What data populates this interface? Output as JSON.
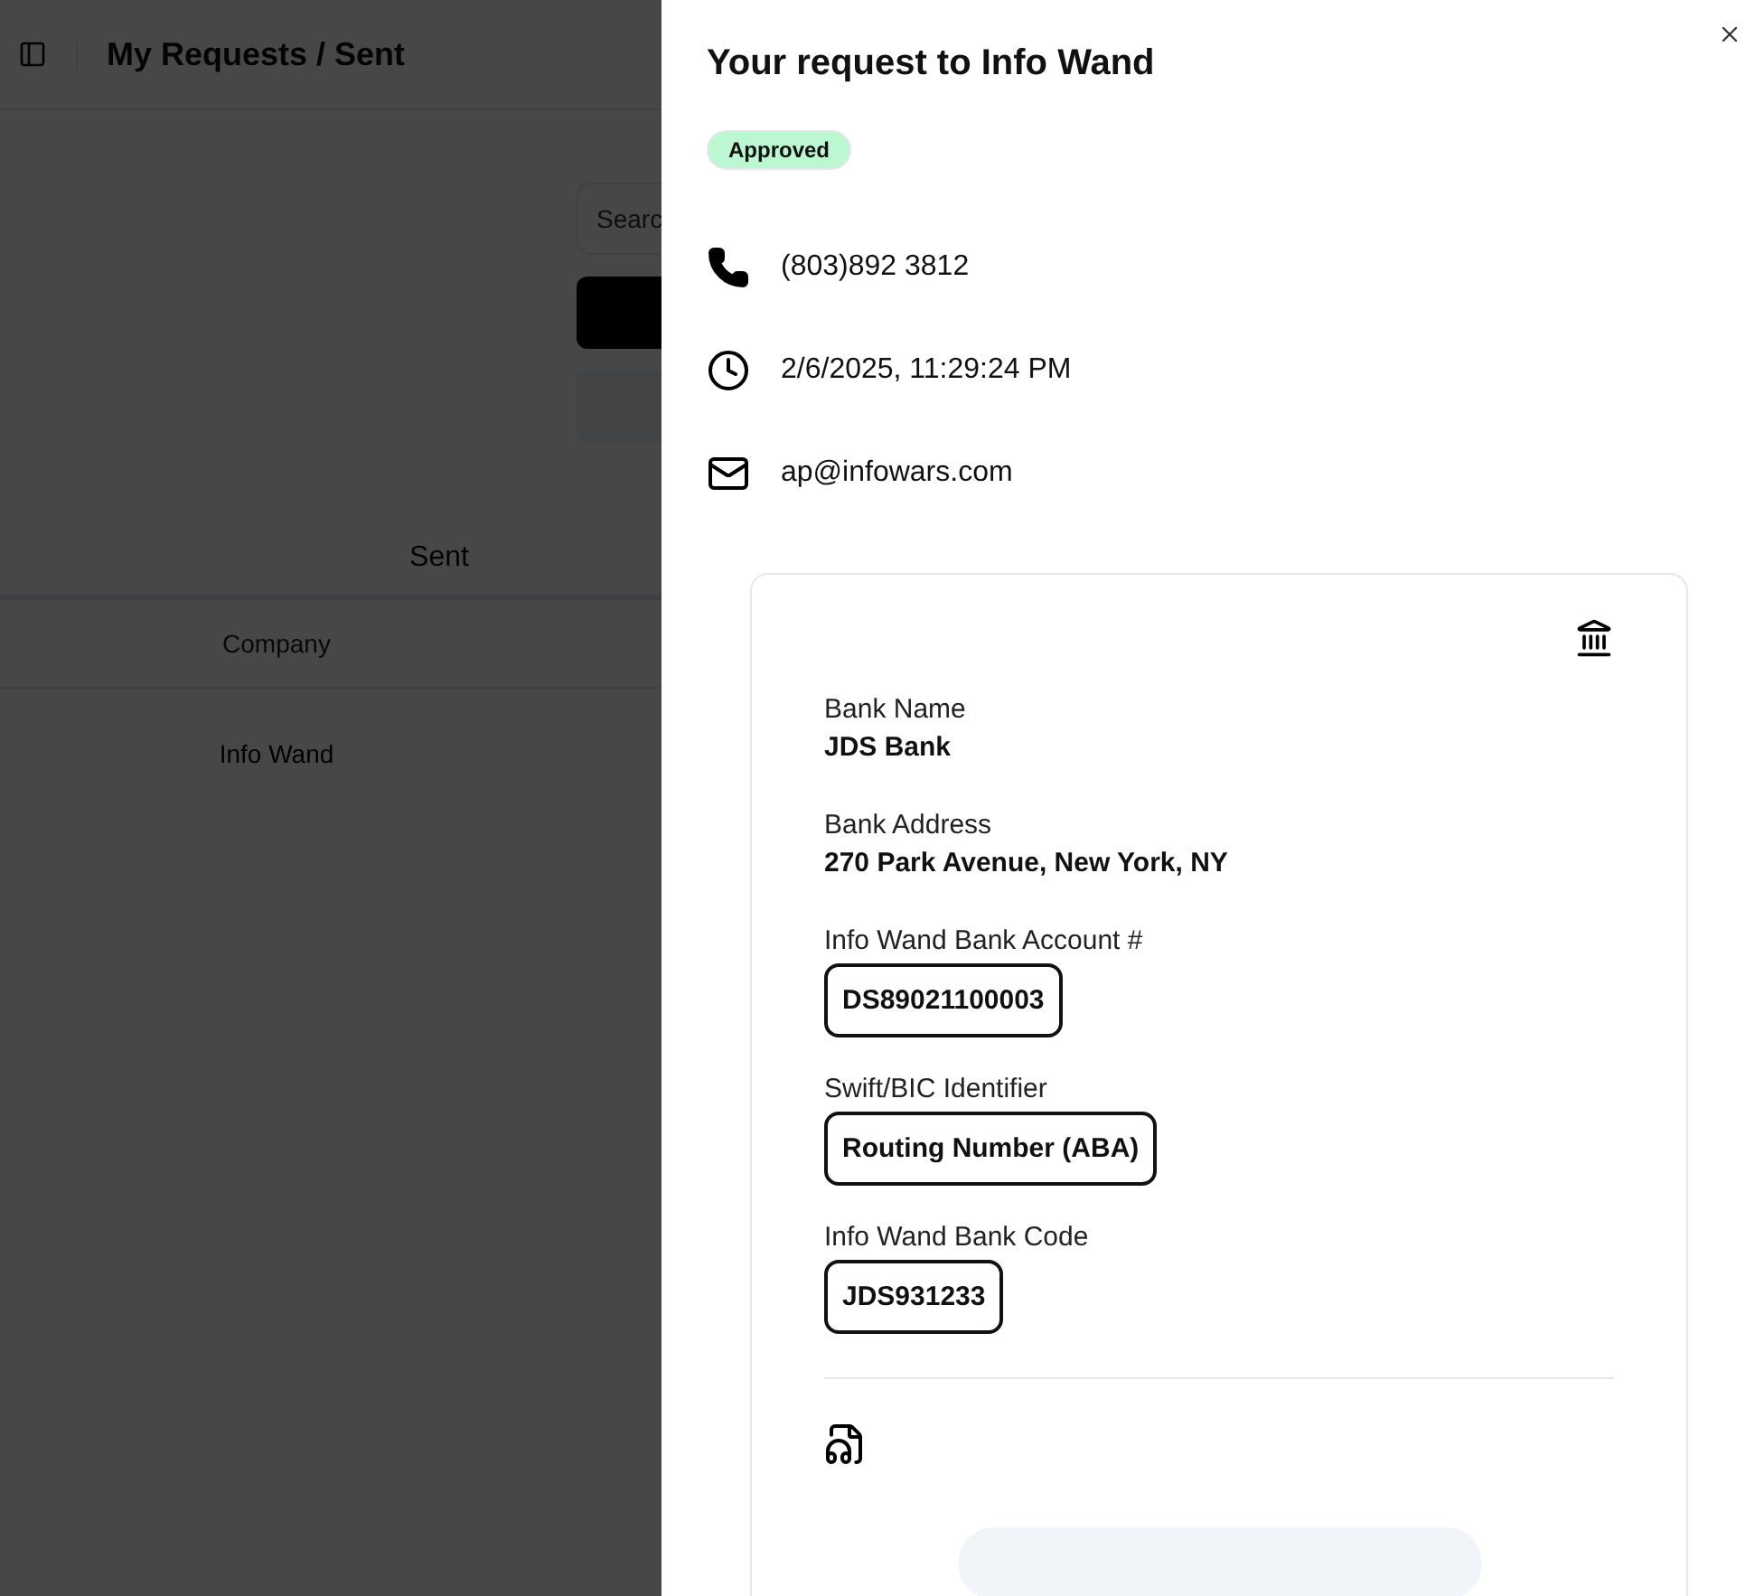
{
  "page": {
    "title": "My Requests / Sent",
    "search": {
      "placeholder": "Searc"
    },
    "tabs": [
      {
        "label": "Sent",
        "selected": true
      }
    ],
    "table": {
      "columns": [
        "Company"
      ],
      "rows": [
        [
          "Info Wand"
        ]
      ]
    }
  },
  "panel": {
    "title": "Your request to Info Wand",
    "status": "Approved",
    "contacts": [
      {
        "kind": "phone",
        "text": "(803)892 3812"
      },
      {
        "kind": "time",
        "text": "2/6/2025, 11:29:24 PM"
      },
      {
        "kind": "email",
        "text": "ap@infowars.com"
      }
    ],
    "bank_fields": [
      {
        "label": "Bank Name",
        "value": "JDS Bank",
        "kind": "plain"
      },
      {
        "label": "Bank Address",
        "value": "270 Park Avenue, New York, NY",
        "kind": "plain"
      },
      {
        "label": "Info Wand Bank Account #",
        "value": "DS89021100003",
        "kind": "boxed"
      },
      {
        "label": "Swift/BIC Identifier",
        "value": "Routing Number (ABA)",
        "kind": "boxed"
      },
      {
        "label": "Info Wand Bank Code",
        "value": "JDS931233",
        "kind": "boxed"
      }
    ]
  }
}
